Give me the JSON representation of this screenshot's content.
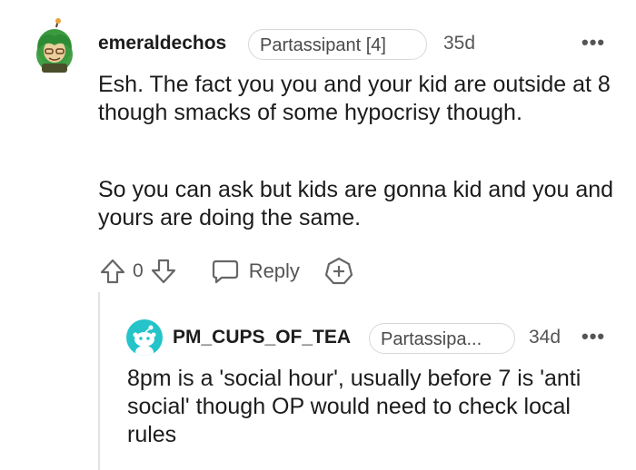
{
  "comment": {
    "username": "emeraldechos",
    "flair": "Partassipant [4]",
    "age": "35d",
    "more": "•••",
    "paragraphs": [
      "Esh. The fact you you and your kid are outside at 8 though smacks of some hypocrisy though.",
      "So you can ask but kids are gonna kid and you and yours are doing the same."
    ],
    "vote_count": "0",
    "reply_label": "Reply"
  },
  "reply": {
    "username": "PM_CUPS_OF_TEA",
    "flair": "Partassipa...",
    "age": "34d",
    "more": "•••",
    "text": "8pm is a 'social hour', usually before 7 is 'anti social' though OP would need to check local rules"
  },
  "colors": {
    "accent_teal": "#24c4c9",
    "avatar_green": "#43a047",
    "text": "#1c1c1c",
    "muted": "#555555"
  },
  "icons": {
    "upvote": "arrow-up-outline",
    "downvote": "arrow-down-outline",
    "reply": "speech-bubble",
    "award": "plus-badge",
    "more": "horizontal-ellipsis"
  }
}
